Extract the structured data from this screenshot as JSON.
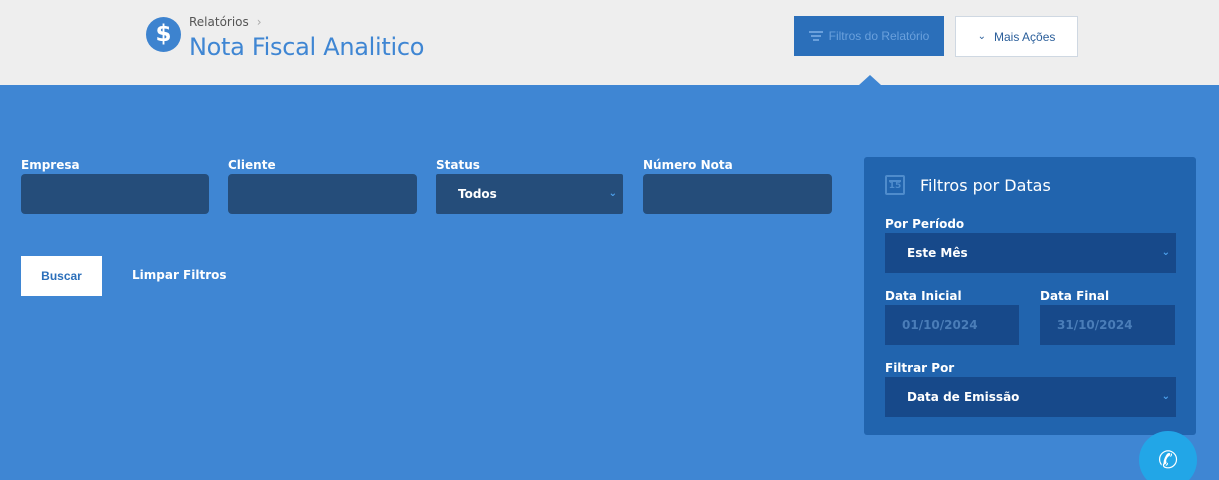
{
  "header": {
    "breadcrumb": "Relatórios",
    "title": "Nota Fiscal Analitico",
    "icon": "dollar-circle-icon",
    "filters_button": "Filtros do Relatório",
    "more_actions_button": "Mais Ações"
  },
  "filters": {
    "empresa_label": "Empresa",
    "cliente_label": "Cliente",
    "status_label": "Status",
    "status_value": "Todos",
    "numero_nota_label": "Número Nota",
    "buscar_button": "Buscar",
    "limpar_button": "Limpar Filtros"
  },
  "date_filters": {
    "title": "Filtros por Datas",
    "periodo_label": "Por Período",
    "periodo_value": "Este Mês",
    "data_inicial_label": "Data Inicial",
    "data_inicial_value": "01/10/2024",
    "data_final_label": "Data Final",
    "data_final_value": "31/10/2024",
    "filtrar_por_label": "Filtrar Por",
    "filtrar_por_value": "Data de Emissão",
    "calendar_day": "15"
  },
  "colors": {
    "header_bg": "#eeeeee",
    "main_bg": "#3f86d3",
    "input_bg": "#254d7a",
    "panel_bg": "#2164ae",
    "accent": "#22a6e7"
  }
}
